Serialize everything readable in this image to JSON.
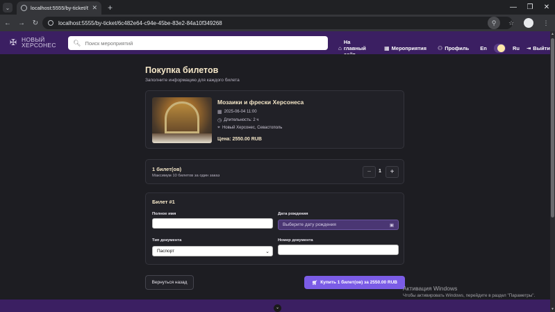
{
  "browser": {
    "tab_title": "localhost:5555/by-ticket/6c48...",
    "url": "localhost:5555/by-ticket/6c482e64-c94e-45be-83e2-84a10f349268"
  },
  "header": {
    "logo_line1": "НОВЫЙ",
    "logo_line2": "ХЕРСОНЕС",
    "search_placeholder": "Поиск мероприятий",
    "nav_home": "На главный сайт",
    "nav_events": "Мероприятия",
    "nav_profile": "Профиль",
    "lang_en": "En",
    "lang_ru": "Ru",
    "logout": "Выйти"
  },
  "page": {
    "title": "Покупка билетов",
    "subtitle": "Заполните информацию для каждого билета"
  },
  "event": {
    "title": "Мозаики и фрески Херсонеса",
    "datetime": "2025-06-04 11:00",
    "duration": "Длительность: 2 ч",
    "location": "Новый Херсонес, Севастополь",
    "price": "Цена: 2550.00 RUB"
  },
  "quantity": {
    "title": "1 билет(ов)",
    "note": "Максимум 10 билетов за один заказ",
    "value": "1",
    "minus": "−",
    "plus": "+"
  },
  "ticket": {
    "title": "Билет #1",
    "full_name_label": "Полное имя",
    "full_name_value": "",
    "birth_date_label": "Дата рождения",
    "birth_date_placeholder": "Выберите дату рождения",
    "doc_type_label": "Тип документа",
    "doc_type_value": "Паспорт",
    "doc_number_label": "Номер документа",
    "doc_number_value": ""
  },
  "actions": {
    "back": "Вернуться назад",
    "buy": "Купить 1 билет(ов) за 2550.00 RUB"
  },
  "watermark": {
    "line1": "Активация Windows",
    "line2": "Чтобы активировать Windows, перейдите в раздел \"Параметры\"."
  },
  "colors": {
    "header_bg": "#3b1f62",
    "accent": "#7b5ce6",
    "heading": "#f5e7c8"
  }
}
